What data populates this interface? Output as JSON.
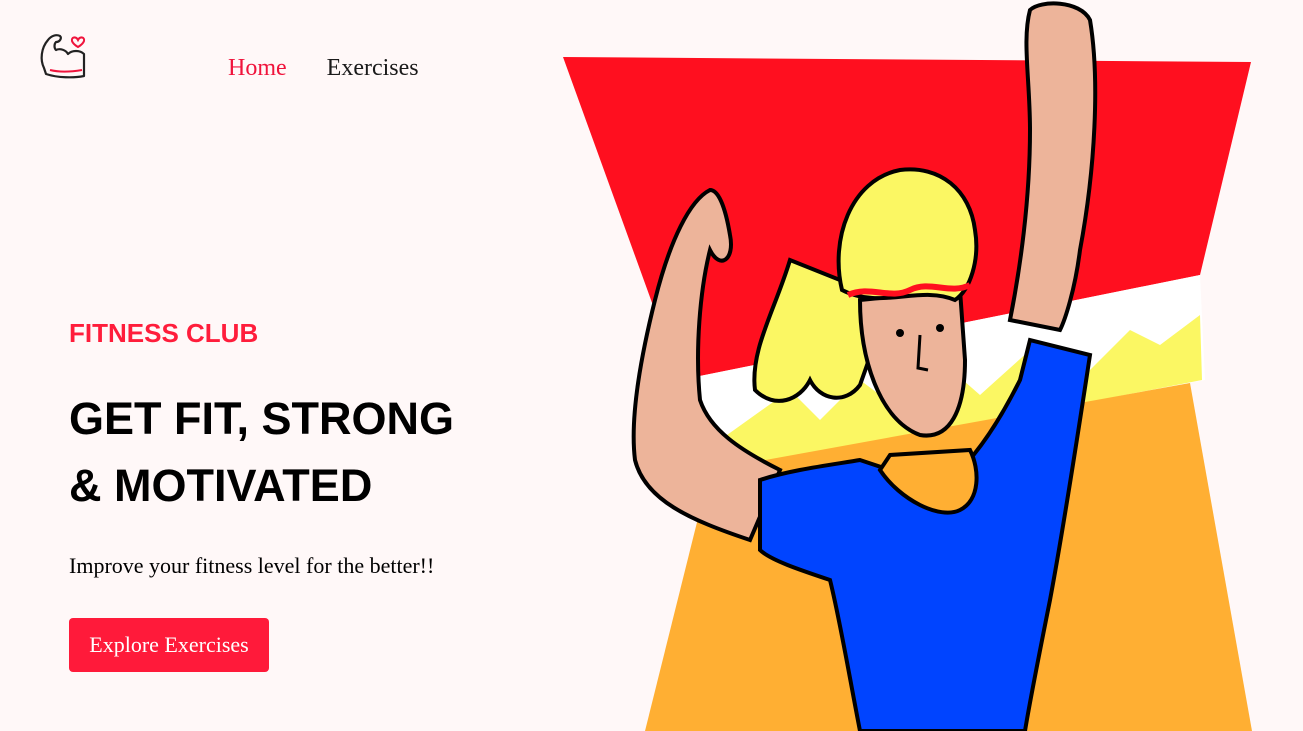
{
  "nav": {
    "logo_icon": "flexed-bicep-heart-icon",
    "links": [
      {
        "label": "Home",
        "active": true
      },
      {
        "label": "Exercises",
        "active": false
      }
    ]
  },
  "hero": {
    "eyebrow": "FITNESS CLUB",
    "headline_line1": "GET FIT, STRONG",
    "headline_line2": "& MOTIVATED",
    "subtitle": "Improve your fitness level for the better!!",
    "cta_label": "Explore Exercises"
  },
  "colors": {
    "accent": "#ff1a3a",
    "background": "#fff8f8",
    "banner_red": "#ff0f1f",
    "banner_orange": "#ffaf33",
    "shirt_blue": "#0044ff",
    "hair_yellow": "#fbf763",
    "skin": "#edb49a"
  },
  "illustration": {
    "icon": "woman-flexing-illustration"
  }
}
